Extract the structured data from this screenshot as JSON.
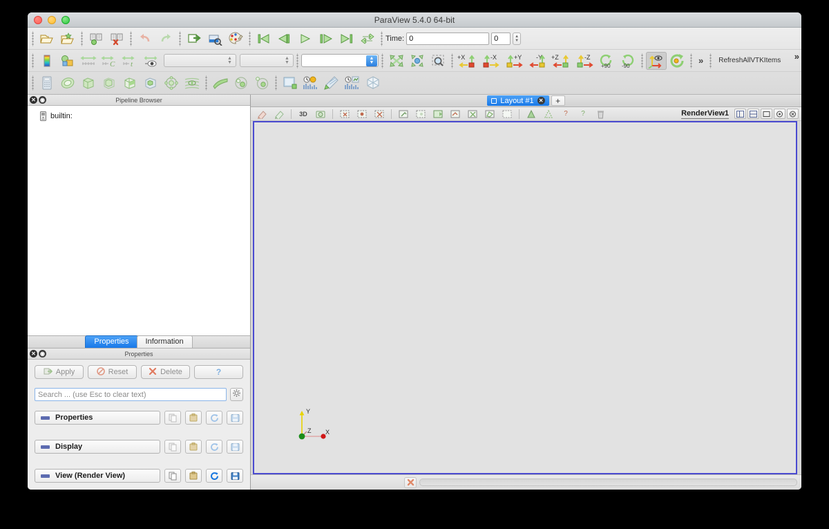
{
  "window": {
    "title": "ParaView 5.4.0 64-bit",
    "traffic_lights": [
      "close",
      "minimize",
      "zoom"
    ]
  },
  "toolbars": {
    "row1": {
      "icons": [
        "open-file-icon",
        "open-recent-icon",
        "save-state-icon",
        "load-state-icon",
        "undo-icon",
        "redo-icon",
        "undo-camera-icon",
        "redo-camera-icon",
        "color-palette-icon",
        "first-frame-icon",
        "previous-frame-icon",
        "play-icon",
        "next-frame-icon",
        "last-frame-icon",
        "loop-icon"
      ],
      "time_label": "Time:",
      "time_value": "0",
      "time_index": "0"
    },
    "row2": {
      "icons": [
        "color-map-icon",
        "rescale-data-range-icon",
        "rescale-custom-range-icon",
        "rescale-temporal-range-icon",
        "rescale-visible-range-icon",
        "edit-color-legend-icon"
      ],
      "array_combo_value": "",
      "component_combo_value": "",
      "representation_combo_value": "",
      "camera_icons": [
        "reset-camera-icon",
        "zoom-to-data-icon",
        "zoom-to-box-icon"
      ],
      "axis_buttons": [
        "+X",
        "-X",
        "+Y",
        "-Y",
        "+Z",
        "-Z"
      ],
      "rotate_buttons": [
        "+90",
        "-90"
      ],
      "extra_icons": [
        "show-center-axes-icon",
        "reset-center-icon"
      ],
      "overflow_label": "»",
      "macro_label": "RefreshAllVTKItems",
      "toolbar_overflow_label": "»"
    },
    "row3": {
      "icons": [
        "calculator-icon",
        "contour-icon",
        "clip-icon",
        "slice-icon",
        "threshold-icon",
        "extract-subset-icon",
        "glyph-icon",
        "stream-tracer-icon",
        "warp-icon",
        "group-datasets-icon",
        "extract-level-icon",
        "plot-over-line-icon",
        "plot-selection-over-time-icon",
        "last-data-icon",
        "plot-data-icon",
        "spreadsheet-icon"
      ]
    }
  },
  "pipeline_browser": {
    "title": "Pipeline Browser",
    "items": [
      {
        "label": "builtin:",
        "icon": "server-icon"
      }
    ]
  },
  "properties_panel": {
    "tabs": [
      {
        "label": "Properties",
        "active": true
      },
      {
        "label": "Information",
        "active": false
      }
    ],
    "dock_title": "Properties",
    "actions": [
      {
        "label": "Apply",
        "icon": "apply-icon",
        "enabled": false
      },
      {
        "label": "Reset",
        "icon": "reset-icon",
        "enabled": false
      },
      {
        "label": "Delete",
        "icon": "delete-icon",
        "enabled": false
      },
      {
        "label": "?",
        "icon": "help-icon",
        "enabled": false
      }
    ],
    "search": {
      "placeholder": "Search ... (use Esc to clear text)",
      "value": ""
    },
    "gear_icon": "gear-icon",
    "groups": [
      {
        "label": "Properties",
        "buttons": [
          "copy-icon",
          "paste-icon",
          "restore-defaults-icon",
          "save-defaults-icon"
        ],
        "enabled": false
      },
      {
        "label": "Display",
        "buttons": [
          "copy-icon",
          "paste-icon",
          "restore-defaults-icon",
          "save-defaults-icon"
        ],
        "enabled": false
      },
      {
        "label": "View (Render View)",
        "buttons": [
          "copy-icon",
          "paste-icon",
          "restore-defaults-icon",
          "save-defaults-icon"
        ],
        "enabled": true
      }
    ]
  },
  "layout": {
    "tab_label": "Layout #1",
    "tab_close": "✕",
    "add_tab_label": "+"
  },
  "render_view": {
    "name": "RenderView1",
    "toolbar_icons": [
      "split-horizontal-icon",
      "split-vertical-icon",
      "maximize-icon",
      "capture-icon",
      "close-view-icon"
    ],
    "view_toolbar_icons": [
      "interaction-mode-icon",
      "camera-undo-icon",
      "3D",
      "camera-icon",
      "select-cells-icon",
      "select-points-icon",
      "select-frustum-cells-icon",
      "select-block-icon",
      "interactive-select-cells-icon",
      "interactive-select-points-icon",
      "hover-cells-icon",
      "hover-points-icon",
      "select-polygon-cells-icon",
      "select-polygon-points-icon",
      "grow-selection-icon",
      "shrink-selection-icon",
      "clear-selection-icon",
      "help-icon",
      "trash-icon"
    ],
    "axes": {
      "x_label": "X",
      "y_label": "Y",
      "z_label": "Z",
      "x_color": "#d01818",
      "y_color": "#e8d400",
      "z_color": "#1a8c1a"
    },
    "background_color": "#e2e2e2",
    "border_color": "#4a4ad0"
  },
  "status_bar": {
    "stop_icon": "abort-icon",
    "progress_value": 0
  }
}
